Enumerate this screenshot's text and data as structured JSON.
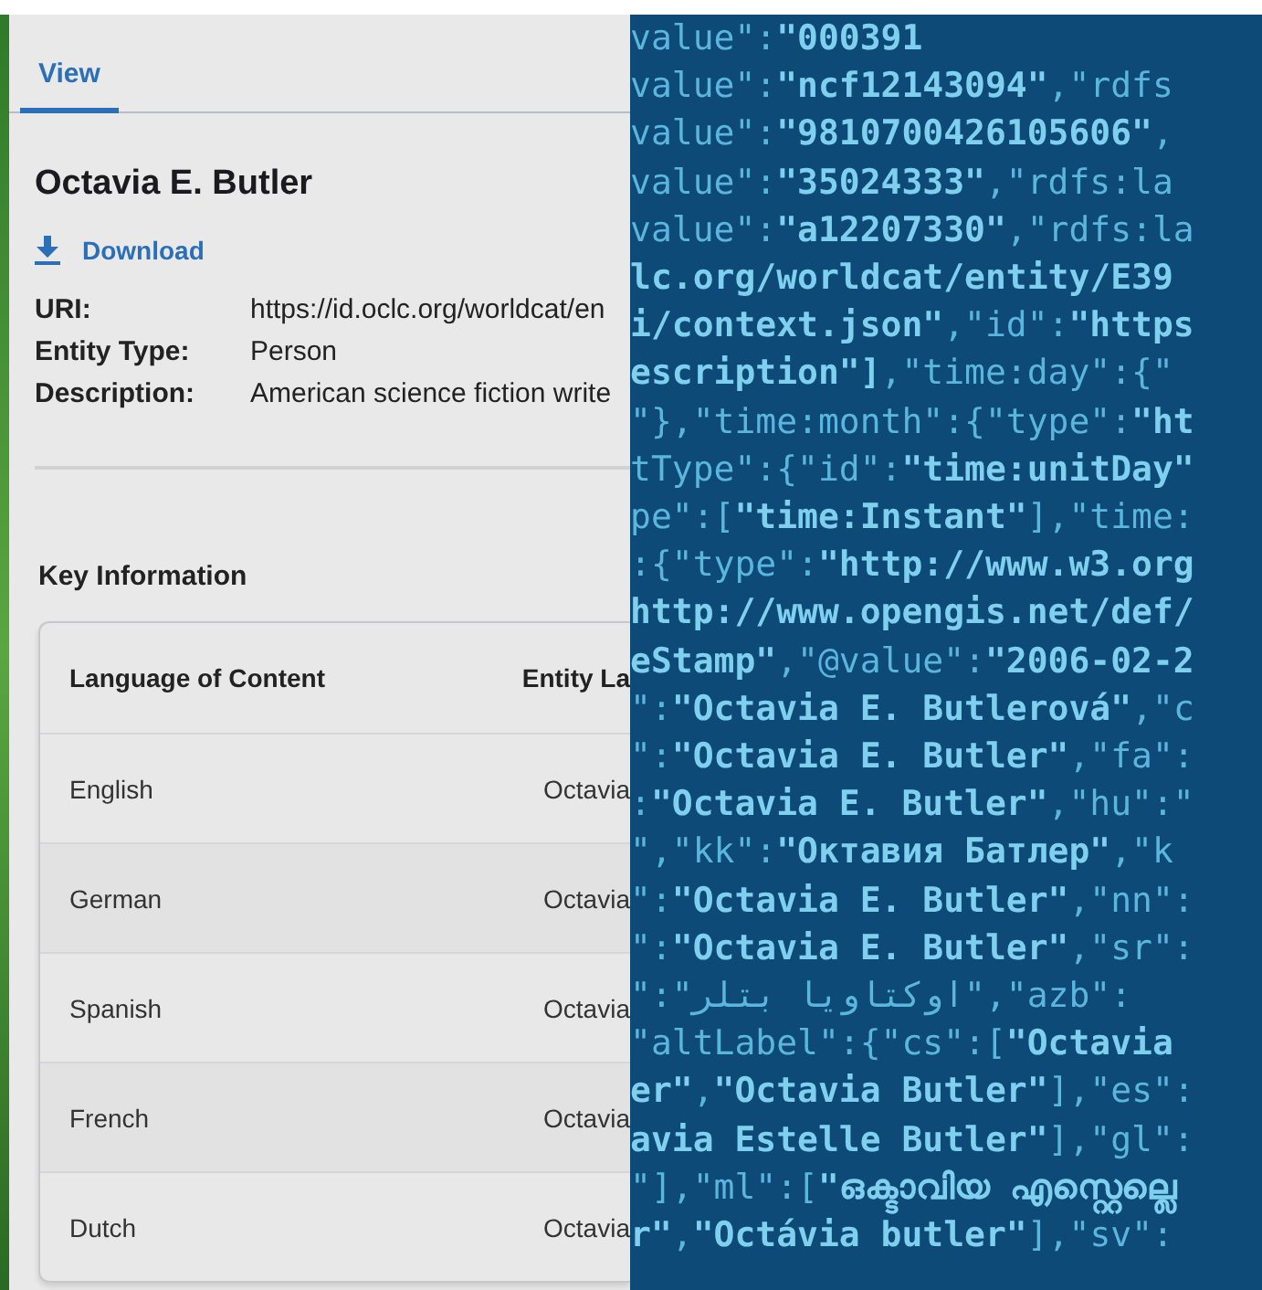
{
  "tabs": [
    {
      "label": "View",
      "selected": true
    }
  ],
  "entity": {
    "title": "Octavia E. Butler",
    "download": "Download",
    "fields": [
      {
        "label": "URI:",
        "value": "https://id.oclc.org/worldcat/en"
      },
      {
        "label": "Entity Type:",
        "value": "Person"
      },
      {
        "label": "Description:",
        "value": "American science fiction write"
      }
    ]
  },
  "key_information": {
    "heading": "Key Information",
    "table": {
      "columns": [
        "Language of Content",
        "Entity La"
      ],
      "rows": [
        [
          "English",
          "Octavia"
        ],
        [
          "German",
          "Octavia"
        ],
        [
          "Spanish",
          "Octavia"
        ],
        [
          "French",
          "Octavia"
        ],
        [
          "Dutch",
          "Octavia"
        ]
      ]
    }
  },
  "code_overlay": {
    "lines": [
      "value\":**\"000391**",
      "value\":**\"ncf12143094\"**,\"rdfs",
      "value\":**\"9810700426105606\"**,",
      "value\":**\"35024333\"**,\"rdfs:la",
      "value\":**\"a12207330\"**,\"rdfs:la",
      "**lc.org/worldcat/entity/E39**",
      "**i/context.json\"**,\"id\":**\"https**",
      "**escription\"]**,\"time:day\":{\"",
      "\"},\"time:month\":{\"type\":**\"ht**",
      "tType\":{\"id\":**\"time:unitDay\"**",
      "pe\":[**\"time:Instant\"**],\"time:",
      ":{\"type\":**\"http://www.w3.org**",
      "**http://www.opengis.net/def/**",
      "**eStamp\"**,\"@value\":**\"2006-02-2**",
      "\":**\"Octavia E. Butlerová\"**,\"c",
      "\":**\"Octavia E. Butler\"**,\"fa\":",
      ":**\"Octavia E. Butler\"**,\"hu\":\"",
      "\",\"kk\":**\"Октавия Батлер\"**,\"k",
      "\":**\"Octavia E. Butler\"**,\"nn\":",
      "\":**\"Octavia E. Butler\"**,\"sr\":",
      "\":\"اوکتاویا بتلر\",\"azb\":",
      "\"altLabel\":{\"cs\":[**\"Octavia**",
      "**er\"**,**\"Octavia Butler\"**],\"es\":",
      "**avia Estelle Butler\"**],\"gl\":",
      "\"],\"ml\":[**\"ഒക്ടാവിയ എസ്റ്റെല്ലെ**",
      "**r\"**,**\"Octávia butler\"**],\"sv\":"
    ]
  }
}
